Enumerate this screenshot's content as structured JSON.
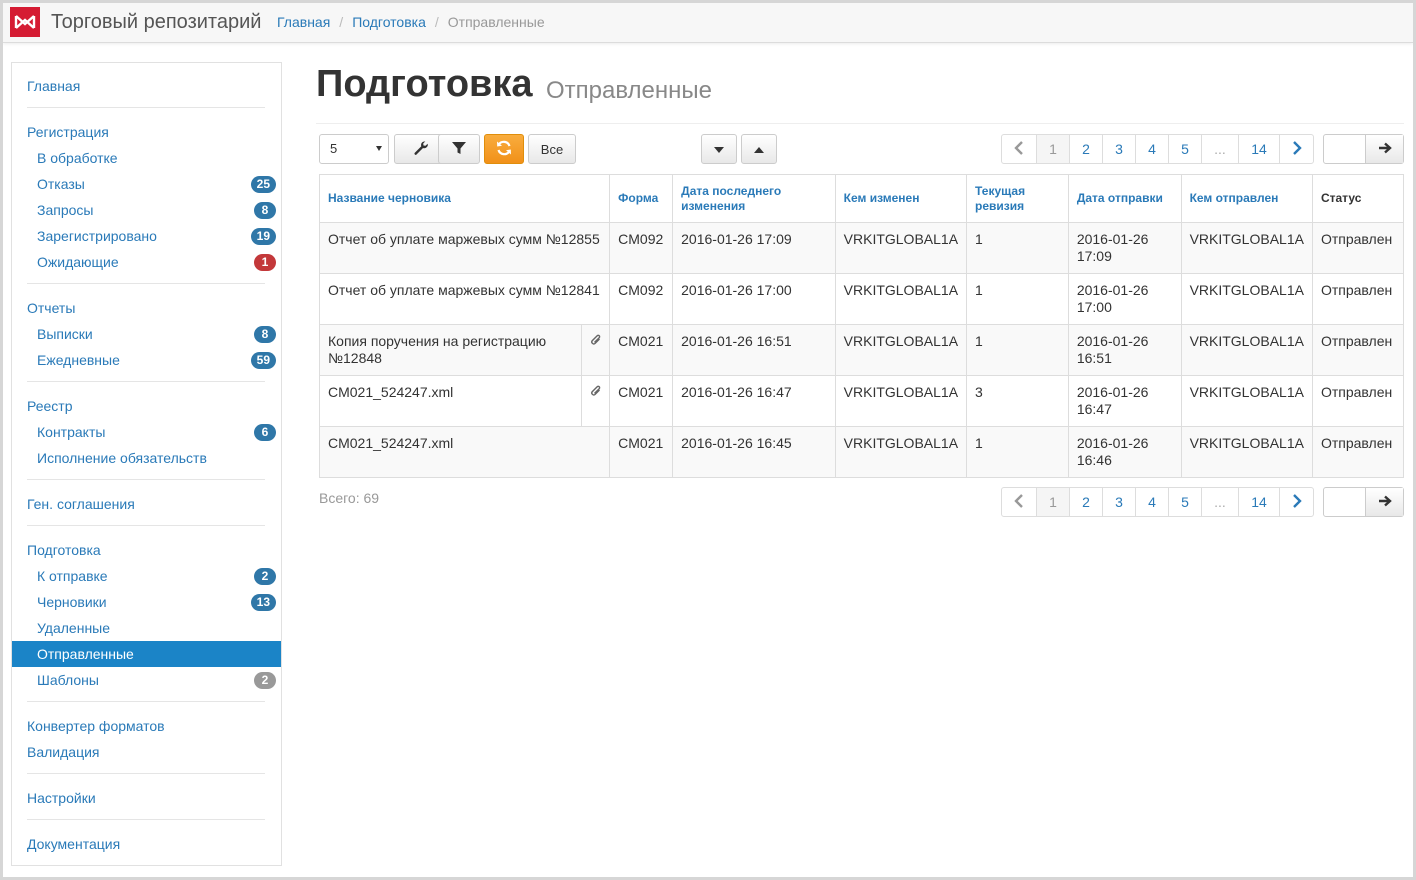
{
  "app": {
    "title": "Торговый репозитарий"
  },
  "breadcrumb": [
    "Главная",
    "Подготовка",
    "Отправленные"
  ],
  "sidebar": {
    "groups": [
      {
        "items": [
          {
            "label": "Главная",
            "level": "top"
          }
        ]
      },
      {
        "items": [
          {
            "label": "Регистрация",
            "level": "top"
          },
          {
            "label": "В обработке",
            "level": "sub"
          },
          {
            "label": "Отказы",
            "level": "sub",
            "badge": "25",
            "badge_color": "#2f77a8"
          },
          {
            "label": "Запросы",
            "level": "sub",
            "badge": "8",
            "badge_color": "#2f77a8"
          },
          {
            "label": "Зарегистрировано",
            "level": "sub",
            "badge": "19",
            "badge_color": "#2f77a8"
          },
          {
            "label": "Ожидающие",
            "level": "sub",
            "badge": "1",
            "badge_color": "#c3383a"
          }
        ]
      },
      {
        "items": [
          {
            "label": "Отчеты",
            "level": "top"
          },
          {
            "label": "Выписки",
            "level": "sub",
            "badge": "8",
            "badge_color": "#2f77a8"
          },
          {
            "label": "Ежедневные",
            "level": "sub",
            "badge": "59",
            "badge_color": "#2f77a8"
          }
        ]
      },
      {
        "items": [
          {
            "label": "Реестр",
            "level": "top"
          },
          {
            "label": "Контракты",
            "level": "sub",
            "badge": "6",
            "badge_color": "#2f77a8"
          },
          {
            "label": "Исполнение обязательств",
            "level": "sub"
          }
        ]
      },
      {
        "items": [
          {
            "label": "Ген. соглашения",
            "level": "top"
          }
        ]
      },
      {
        "items": [
          {
            "label": "Подготовка",
            "level": "top"
          },
          {
            "label": "К отправке",
            "level": "sub",
            "badge": "2",
            "badge_color": "#2f77a8"
          },
          {
            "label": "Черновики",
            "level": "sub",
            "badge": "13",
            "badge_color": "#2f77a8"
          },
          {
            "label": "Удаленные",
            "level": "sub"
          },
          {
            "label": "Отправленные",
            "level": "sub",
            "active": true
          },
          {
            "label": "Шаблоны",
            "level": "sub",
            "badge": "2",
            "badge_color": "#999999"
          }
        ]
      },
      {
        "items": [
          {
            "label": "Конвертер форматов",
            "level": "top"
          },
          {
            "label": "Валидация",
            "level": "top"
          }
        ]
      },
      {
        "items": [
          {
            "label": "Настройки",
            "level": "top"
          }
        ]
      },
      {
        "items": [
          {
            "label": "Документация",
            "level": "top"
          }
        ]
      }
    ]
  },
  "header": {
    "title": "Подготовка",
    "subtitle": "Отправленные"
  },
  "toolbar": {
    "page_size": "5",
    "settings_icon": "wrench-icon",
    "filter_icon": "filter-icon",
    "refresh_icon": "refresh-icon",
    "all_label": "Все",
    "accent_color": "#f19119"
  },
  "pagination": {
    "pages": [
      "1",
      "2",
      "3",
      "4",
      "5",
      "...",
      "14"
    ],
    "current": "1"
  },
  "table": {
    "columns": [
      "Название черновика",
      "Форма",
      "Дата последнего изменения",
      "Кем изменен",
      "Текущая ревизия",
      "Дата отправки",
      "Кем отправлен",
      "Статус"
    ],
    "rows": [
      {
        "name": "Отчет об уплате маржевых сумм №12855",
        "attachment": false,
        "form": "CM092",
        "modified": "2016-01-26 17:09",
        "modified_by": "VRKITGLOBAL1A",
        "revision": "1",
        "sent": "2016-01-26 17:09",
        "sent_by": "VRKITGLOBAL1A",
        "status": "Отправлен"
      },
      {
        "name": "Отчет об уплате маржевых сумм №12841",
        "attachment": false,
        "form": "CM092",
        "modified": "2016-01-26 17:00",
        "modified_by": "VRKITGLOBAL1A",
        "revision": "1",
        "sent": "2016-01-26 17:00",
        "sent_by": "VRKITGLOBAL1A",
        "status": "Отправлен"
      },
      {
        "name": "Копия поручения на регистрацию №12848",
        "attachment": true,
        "form": "CM021",
        "modified": "2016-01-26 16:51",
        "modified_by": "VRKITGLOBAL1A",
        "revision": "1",
        "sent": "2016-01-26 16:51",
        "sent_by": "VRKITGLOBAL1A",
        "status": "Отправлен"
      },
      {
        "name": "CM021_524247.xml",
        "attachment": true,
        "form": "CM021",
        "modified": "2016-01-26 16:47",
        "modified_by": "VRKITGLOBAL1A",
        "revision": "3",
        "sent": "2016-01-26 16:47",
        "sent_by": "VRKITGLOBAL1A",
        "status": "Отправлен"
      },
      {
        "name": "CM021_524247.xml",
        "attachment": false,
        "form": "CM021",
        "modified": "2016-01-26 16:45",
        "modified_by": "VRKITGLOBAL1A",
        "revision": "1",
        "sent": "2016-01-26 16:46",
        "sent_by": "VRKITGLOBAL1A",
        "status": "Отправлен"
      }
    ]
  },
  "footer": {
    "total": "Всего: 69"
  }
}
